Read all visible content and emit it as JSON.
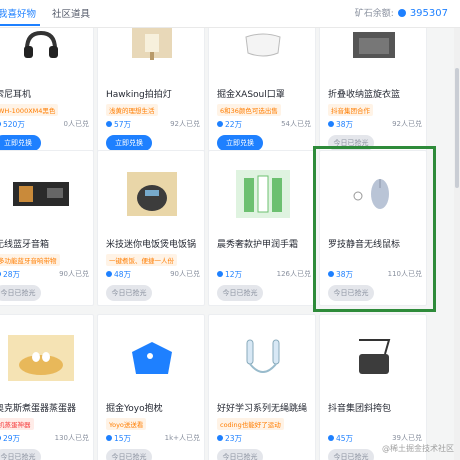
{
  "tabs": [
    {
      "label": "我喜好物",
      "active": true
    },
    {
      "label": "社区道具",
      "active": false
    }
  ],
  "balance": {
    "label": "矿石余额:",
    "value": "395307"
  },
  "cards": [
    {
      "name": "索尼耳机",
      "tag": "WH-1000XM4黑色",
      "tag_color": "orange",
      "price": "520万",
      "sold": "0人已兑",
      "button": "立即兑换",
      "button_style": "blue",
      "icon": "headphones-icon"
    },
    {
      "name": "Hawking拍拍灯",
      "tag": "浅黄的理想生活",
      "tag_color": "orange",
      "price": "57万",
      "sold": "92人已兑",
      "button": "立即兑换",
      "button_style": "blue",
      "icon": "lamp-icon"
    },
    {
      "name": "掘金XASoul口罩",
      "tag": "6和36颜色可选出售",
      "tag_color": "orange",
      "price": "22万",
      "sold": "54人已兑",
      "button": "立即兑换",
      "button_style": "blue",
      "icon": "mask-icon"
    },
    {
      "name": "折叠收纳篮旋衣篮",
      "tag": "抖音集团合作",
      "tag_color": "orange",
      "price": "38万",
      "sold": "92人已兑",
      "button": "今日已抢光",
      "button_style": "gray",
      "icon": "basket-icon"
    },
    {
      "name": "无线蓝牙音箱",
      "tag": "多功能蓝牙音响带物",
      "tag_color": "orange",
      "price": "28万",
      "sold": "90人已兑",
      "button": "今日已抢光",
      "button_style": "gray",
      "icon": "speaker-icon"
    },
    {
      "name": "米技迷你电饭煲电饭锅",
      "tag": "一键煮饭、便捷一人份",
      "tag_color": "orange",
      "price": "48万",
      "sold": "90人已兑",
      "button": "今日已抢光",
      "button_style": "gray",
      "icon": "rice-cooker-icon"
    },
    {
      "name": "晨秀奢款护甲润手霜",
      "tag": "",
      "tag_color": "orange",
      "price": "12万",
      "sold": "126人已兑",
      "button": "今日已抢光",
      "button_style": "gray",
      "icon": "hand-cream-icon"
    },
    {
      "name": "罗技静音无线鼠标",
      "tag": "",
      "tag_color": "orange",
      "price": "38万",
      "sold": "110人已兑",
      "button": "今日已抢光",
      "button_style": "gray",
      "icon": "mouse-icon"
    },
    {
      "name": "奥克斯煮蛋器蒸蛋器",
      "tag": "机蒸蛋神器",
      "tag_color": "red",
      "price": "29万",
      "sold": "130人已兑",
      "button": "今日已抢光",
      "button_style": "gray",
      "icon": "egg-steamer-icon"
    },
    {
      "name": "掘金Yoyo抱枕",
      "tag": "Yoyo送送看",
      "tag_color": "orange",
      "price": "15万",
      "sold": "1k+人已兑",
      "button": "今日已抢光",
      "button_style": "gray",
      "icon": "pillow-icon"
    },
    {
      "name": "好好学习系列无绳跳绳",
      "tag": "coding也能好了运动",
      "tag_color": "orange",
      "price": "23万",
      "sold": "",
      "button": "今日已抢光",
      "button_style": "gray",
      "icon": "jump-rope-icon"
    },
    {
      "name": "抖音集团斜挎包",
      "tag": "",
      "tag_color": "orange",
      "price": "45万",
      "sold": "39人已兑",
      "button": "今日已抢光",
      "button_style": "gray",
      "icon": "crossbody-bag-icon"
    }
  ],
  "watermark": "@稀土掘金技术社区"
}
